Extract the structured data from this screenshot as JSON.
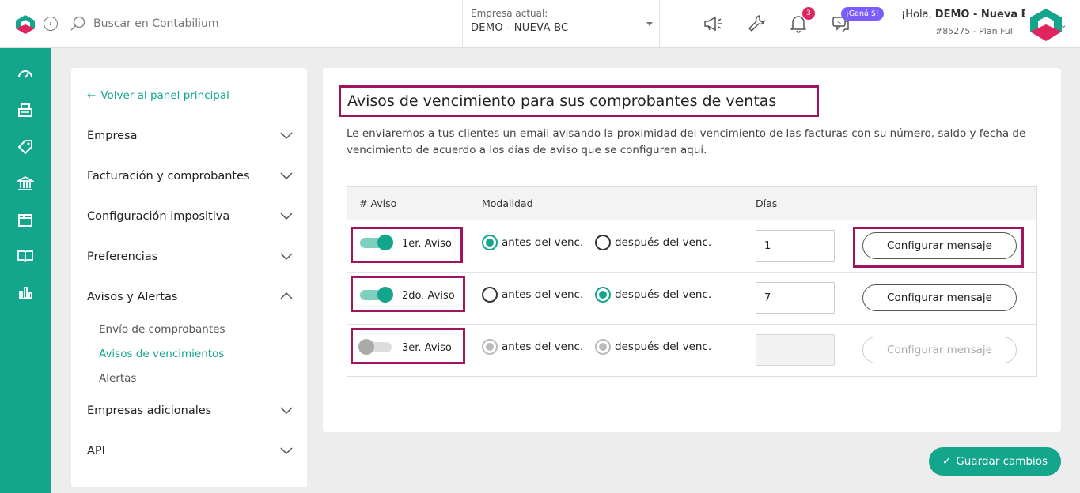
{
  "header": {
    "search_placeholder": "Buscar en Contabilium",
    "company_label": "Empresa actual:",
    "company_value": "DEMO - NUEVA BC",
    "notif_count": "3",
    "gana_badge": "¡Ganá $!",
    "greeting_prefix": "¡Hola, ",
    "greeting_name": "DEMO - Nueva BC",
    "plan": "#85275 - Plan Full"
  },
  "sidebar": {
    "back_label": "Volver al panel principal",
    "sections": [
      {
        "label": "Empresa"
      },
      {
        "label": "Facturación y comprobantes"
      },
      {
        "label": "Configuración impositiva"
      },
      {
        "label": "Preferencias"
      },
      {
        "label": "Avisos y Alertas"
      },
      {
        "label": "Empresas adicionales"
      },
      {
        "label": "API"
      }
    ],
    "subitems": [
      {
        "label": "Envío de comprobantes"
      },
      {
        "label": "Avisos de vencimientos"
      },
      {
        "label": "Alertas"
      }
    ]
  },
  "main": {
    "title": "Avisos de vencimiento para sus comprobantes de ventas",
    "description": "Le enviaremos a tus clientes un email avisando la proximidad del vencimiento de las facturas con su número, saldo y fecha de vencimiento de acuerdo a los días de aviso que se configuren aquí.",
    "columns": {
      "aviso": "# Aviso",
      "modalidad": "Modalidad",
      "dias": "Días"
    },
    "rows": [
      {
        "label": "1er. Aviso",
        "enabled": true,
        "antes": "antes del venc.",
        "despues": "después del venc.",
        "mode": "antes",
        "dias": "1",
        "button": "Configurar mensaje"
      },
      {
        "label": "2do. Aviso",
        "enabled": true,
        "antes": "antes del venc.",
        "despues": "después del venc.",
        "mode": "despues",
        "dias": "7",
        "button": "Configurar mensaje"
      },
      {
        "label": "3er. Aviso",
        "enabled": false,
        "antes": "antes del venc.",
        "despues": "después del venc.",
        "mode": "both-disabled",
        "dias": "",
        "button": "Configurar mensaje"
      }
    ],
    "save_label": "Guardar cambios"
  },
  "colors": {
    "brand": "#14a58d",
    "highlight": "#a3145f",
    "badge": "#e0245e",
    "promo": "#7b5cff"
  }
}
